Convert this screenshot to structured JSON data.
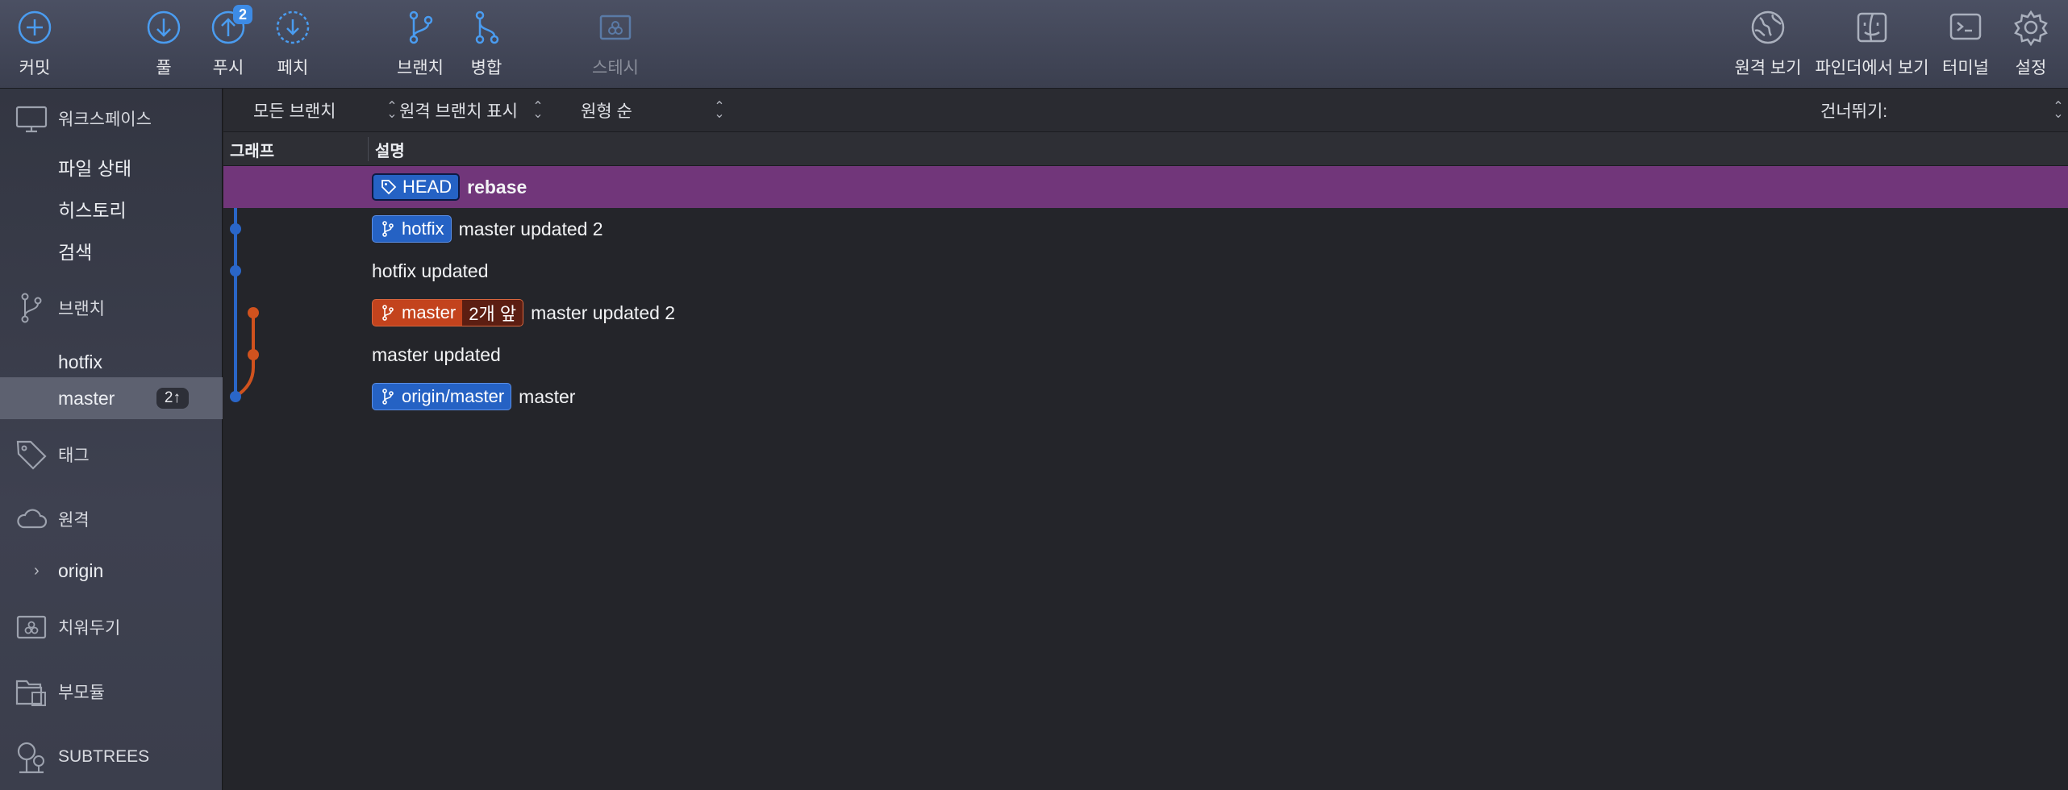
{
  "toolbar": {
    "commit": "커밋",
    "pull": "풀",
    "push": "푸시",
    "push_badge": "2",
    "fetch": "페치",
    "branch": "브랜치",
    "merge": "병합",
    "stash": "스테시",
    "show_remote": "원격 보기",
    "show_in_finder": "파인더에서 보기",
    "terminal": "터미널",
    "settings": "설정"
  },
  "sidebar": {
    "workspace": "워크스페이스",
    "workspace_items": [
      "파일 상태",
      "히스토리",
      "검색"
    ],
    "branches": "브랜치",
    "branch_items": [
      {
        "label": "hotfix",
        "badge": ""
      },
      {
        "label": "master",
        "badge": "2↑",
        "selected": true
      }
    ],
    "tags": "태그",
    "remotes": "원격",
    "remote_items": [
      "origin"
    ],
    "stashes": "치워두기",
    "submodules": "부모듈",
    "subtrees": "SUBTREES"
  },
  "filterbar": {
    "branches": "모든 브랜치",
    "remote_display": "원격 브랜치 표시",
    "order": "원형 순",
    "jump_to": "건너뛰기:"
  },
  "columns": {
    "graph": "그래프",
    "description": "설명"
  },
  "commits": [
    {
      "tags": [
        {
          "label": "HEAD",
          "kind": "head"
        }
      ],
      "message": "rebase",
      "selected": true
    },
    {
      "tags": [
        {
          "label": "hotfix",
          "kind": "branch-blue"
        }
      ],
      "message": "master updated 2"
    },
    {
      "tags": [],
      "message": "hotfix updated"
    },
    {
      "tags": [
        {
          "label": "master",
          "kind": "branch-orange",
          "ahead": "2개 앞"
        }
      ],
      "message": "master updated 2"
    },
    {
      "tags": [],
      "message": "master updated"
    },
    {
      "tags": [
        {
          "label": "origin/master",
          "kind": "branch-blue"
        }
      ],
      "message": "master"
    }
  ],
  "colors": {
    "accent": "#3d8be5",
    "selected_row": "#71367a",
    "lane_blue": "#2a66c8",
    "lane_orange": "#d0521e"
  }
}
